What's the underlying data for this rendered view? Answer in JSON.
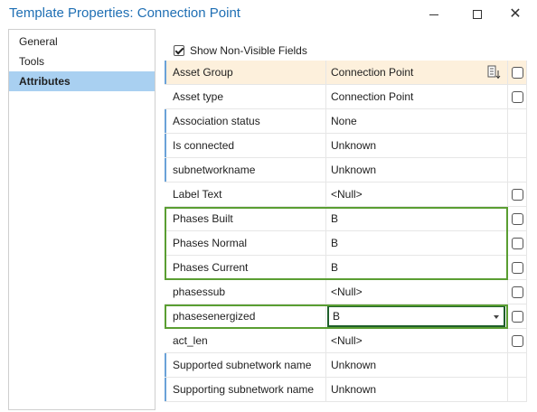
{
  "window": {
    "title": "Template Properties: Connection Point",
    "close_glyph": "✕"
  },
  "nav": {
    "items": [
      {
        "label": "General",
        "active": false
      },
      {
        "label": "Tools",
        "active": false
      },
      {
        "label": "Attributes",
        "active": true
      }
    ]
  },
  "options": {
    "show_non_visible_label": "Show Non-Visible Fields",
    "show_non_visible_checked": true
  },
  "grid": {
    "header": {
      "name": "Asset Group",
      "value": "Connection Point"
    },
    "rows": [
      {
        "name": "Asset type",
        "value": "Connection Point"
      },
      {
        "name": "Association status",
        "value": "None"
      },
      {
        "name": "Is connected",
        "value": "Unknown"
      },
      {
        "name": "subnetworkname",
        "value": "Unknown"
      },
      {
        "name": "Label Text",
        "value": "<Null>"
      },
      {
        "name": "Phases Built",
        "value": "B"
      },
      {
        "name": "Phases Normal",
        "value": "B"
      },
      {
        "name": "Phases Current",
        "value": "B"
      },
      {
        "name": "phasessub",
        "value": "<Null>"
      },
      {
        "name": "phasesenergized",
        "value": "B"
      },
      {
        "name": "act_len",
        "value": "<Null>"
      },
      {
        "name": "Supported subnetwork name",
        "value": "Unknown"
      },
      {
        "name": "Supporting subnetwork name",
        "value": "Unknown"
      }
    ]
  },
  "colors": {
    "title": "#1f6fb4",
    "nav_active": "#a9d0f1",
    "header_row": "#fdf0dc",
    "highlight_border": "#5a9e32",
    "row_edge": "#6aa2d8"
  }
}
